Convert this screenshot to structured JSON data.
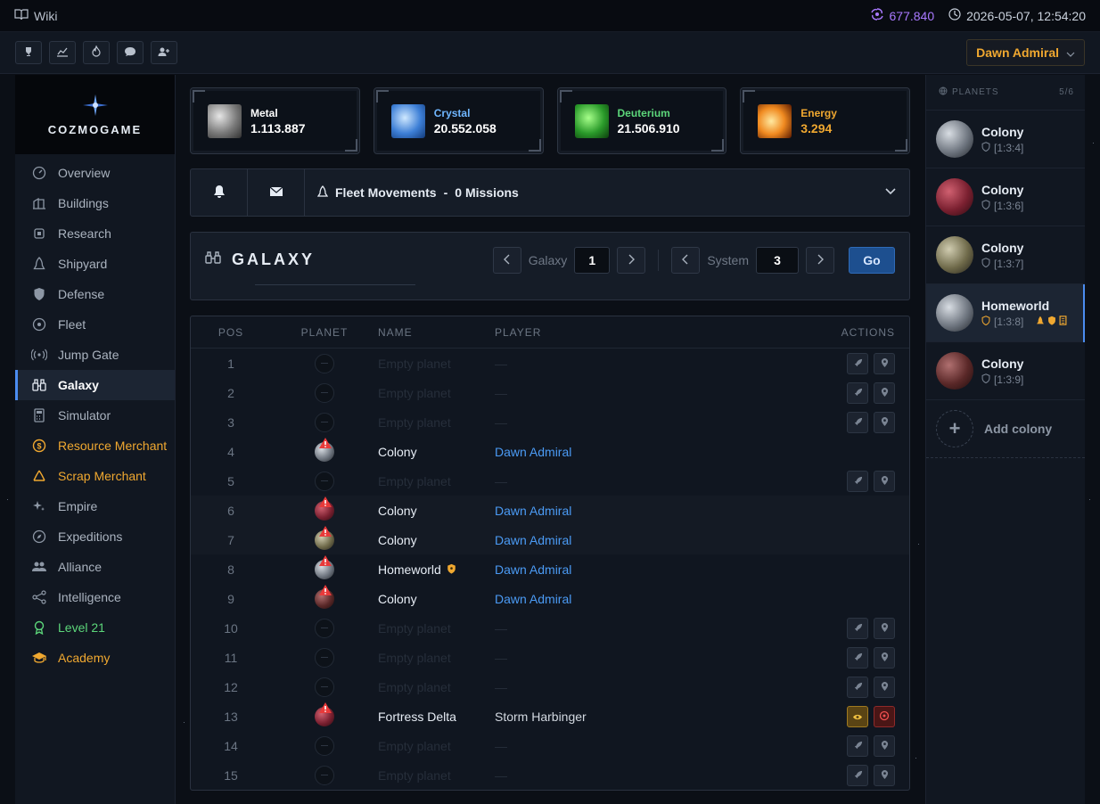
{
  "topbar": {
    "wiki_label": "Wiki",
    "dark_matter": "677.840",
    "datetime": "2026-05-07, 12:54:20"
  },
  "toolbar": {
    "user_name": "Dawn Admiral"
  },
  "logo": {
    "text": "COZMOGAME"
  },
  "nav": [
    {
      "label": "Overview",
      "icon": "gauge-icon",
      "style": ""
    },
    {
      "label": "Buildings",
      "icon": "buildings-icon",
      "style": ""
    },
    {
      "label": "Research",
      "icon": "chip-icon",
      "style": ""
    },
    {
      "label": "Shipyard",
      "icon": "rocket-icon",
      "style": ""
    },
    {
      "label": "Defense",
      "icon": "shield-icon",
      "style": ""
    },
    {
      "label": "Fleet",
      "icon": "target-icon",
      "style": ""
    },
    {
      "label": "Jump Gate",
      "icon": "broadcast-icon",
      "style": ""
    },
    {
      "label": "Galaxy",
      "icon": "binoculars-icon",
      "style": "active"
    },
    {
      "label": "Simulator",
      "icon": "calculator-icon",
      "style": ""
    },
    {
      "label": "Resource Merchant",
      "icon": "coin-icon",
      "style": "gold"
    },
    {
      "label": "Scrap Merchant",
      "icon": "recycle-icon",
      "style": "gold"
    },
    {
      "label": "Empire",
      "icon": "sparkles-icon",
      "style": ""
    },
    {
      "label": "Expeditions",
      "icon": "compass-icon",
      "style": ""
    },
    {
      "label": "Alliance",
      "icon": "people-icon",
      "style": ""
    },
    {
      "label": "Intelligence",
      "icon": "share-icon",
      "style": ""
    },
    {
      "label": "Level 21",
      "icon": "award-icon",
      "style": "green"
    },
    {
      "label": "Academy",
      "icon": "mortarboard-icon",
      "style": "gold"
    }
  ],
  "resources": [
    {
      "name": "Metal",
      "value": "1.113.887",
      "color": "#ffffff",
      "value_color": "#ffffff"
    },
    {
      "name": "Crystal",
      "value": "20.552.058",
      "color": "#6fb6ff",
      "value_color": "#ffffff"
    },
    {
      "name": "Deuterium",
      "value": "21.506.910",
      "color": "#5cd67a",
      "value_color": "#ffffff"
    },
    {
      "name": "Energy",
      "value": "3.294",
      "color": "#f0a830",
      "value_color": "#f0a830"
    }
  ],
  "fleet": {
    "label": "Fleet Movements",
    "sep": "-",
    "missions": "0 Missions"
  },
  "galaxy": {
    "title": "GALAXY",
    "galaxy_label": "Galaxy",
    "galaxy_value": "1",
    "system_label": "System",
    "system_value": "3",
    "go_label": "Go"
  },
  "table": {
    "headers": {
      "pos": "POS",
      "planet": "PLANET",
      "name": "NAME",
      "player": "PLAYER",
      "actions": "ACTIONS"
    },
    "rows": [
      {
        "pos": "1",
        "name": "Empty planet",
        "player": "—",
        "type": "empty"
      },
      {
        "pos": "2",
        "name": "Empty planet",
        "player": "—",
        "type": "empty"
      },
      {
        "pos": "3",
        "name": "Empty planet",
        "player": "—",
        "type": "empty"
      },
      {
        "pos": "4",
        "name": "Colony",
        "player": "Dawn Admiral",
        "type": "own",
        "planet": "grey"
      },
      {
        "pos": "5",
        "name": "Empty planet",
        "player": "—",
        "type": "empty"
      },
      {
        "pos": "6",
        "name": "Colony",
        "player": "Dawn Admiral",
        "type": "own",
        "planet": "red"
      },
      {
        "pos": "7",
        "name": "Colony",
        "player": "Dawn Admiral",
        "type": "own",
        "planet": "olive"
      },
      {
        "pos": "8",
        "name": "Homeworld",
        "player": "Dawn Admiral",
        "type": "own",
        "planet": "grey",
        "home": true
      },
      {
        "pos": "9",
        "name": "Colony",
        "player": "Dawn Admiral",
        "type": "own",
        "planet": "darkred"
      },
      {
        "pos": "10",
        "name": "Empty planet",
        "player": "—",
        "type": "empty"
      },
      {
        "pos": "11",
        "name": "Empty planet",
        "player": "—",
        "type": "empty"
      },
      {
        "pos": "12",
        "name": "Empty planet",
        "player": "—",
        "type": "empty"
      },
      {
        "pos": "13",
        "name": "Fortress Delta",
        "player": "Storm Harbinger",
        "type": "other",
        "planet": "red"
      },
      {
        "pos": "14",
        "name": "Empty planet",
        "player": "—",
        "type": "empty"
      },
      {
        "pos": "15",
        "name": "Empty planet",
        "player": "—",
        "type": "empty"
      }
    ]
  },
  "planets_panel": {
    "title": "PLANETS",
    "count": "5/6",
    "items": [
      {
        "name": "Colony",
        "coord": "[1:3:4]",
        "ball": "grey",
        "active": false
      },
      {
        "name": "Colony",
        "coord": "[1:3:6]",
        "ball": "red",
        "active": false
      },
      {
        "name": "Colony",
        "coord": "[1:3:7]",
        "ball": "olive",
        "active": false
      },
      {
        "name": "Homeworld",
        "coord": "[1:3:8]",
        "ball": "grey",
        "active": true
      },
      {
        "name": "Colony",
        "coord": "[1:3:9]",
        "ball": "darkred",
        "active": false
      }
    ],
    "add_label": "Add colony"
  }
}
